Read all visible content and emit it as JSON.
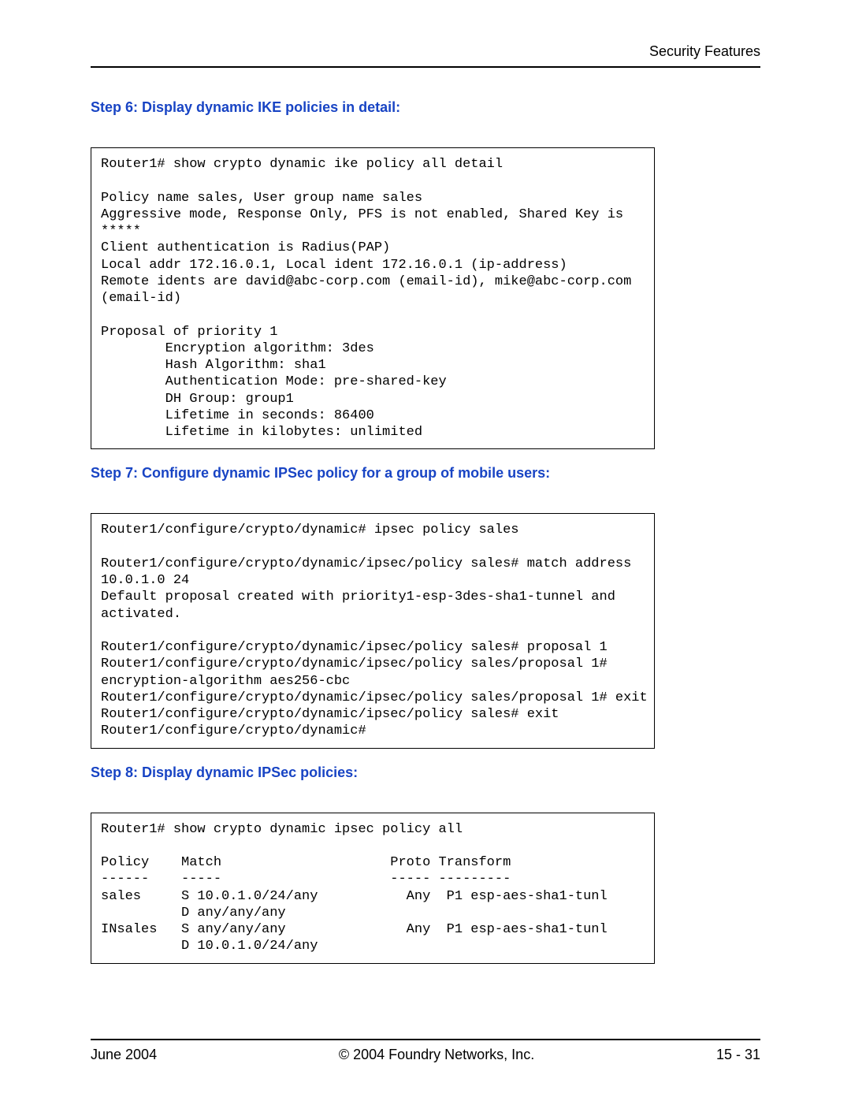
{
  "header": {
    "right_text": "Security Features"
  },
  "sections": {
    "step6": {
      "heading": "Step 6: Display dynamic IKE policies in detail:",
      "code": "Router1# show crypto dynamic ike policy all detail\n\nPolicy name sales, User group name sales\nAggressive mode, Response Only, PFS is not enabled, Shared Key is \n*****\nClient authentication is Radius(PAP)\nLocal addr 172.16.0.1, Local ident 172.16.0.1 (ip-address)\nRemote idents are david@abc-corp.com (email-id), mike@abc-corp.com \n(email-id)\n\nProposal of priority 1\n        Encryption algorithm: 3des\n        Hash Algorithm: sha1\n        Authentication Mode: pre-shared-key\n        DH Group: group1\n        Lifetime in seconds: 86400\n        Lifetime in kilobytes: unlimited"
    },
    "step7": {
      "heading": "Step 7: Configure dynamic IPSec policy for a group of mobile users:",
      "code": "Router1/configure/crypto/dynamic# ipsec policy sales\n\nRouter1/configure/crypto/dynamic/ipsec/policy sales# match address \n10.0.1.0 24\nDefault proposal created with priority1-esp-3des-sha1-tunnel and \nactivated.\n\nRouter1/configure/crypto/dynamic/ipsec/policy sales# proposal 1\nRouter1/configure/crypto/dynamic/ipsec/policy sales/proposal 1# \nencryption-algorithm aes256-cbc\nRouter1/configure/crypto/dynamic/ipsec/policy sales/proposal 1# exit\nRouter1/configure/crypto/dynamic/ipsec/policy sales# exit\nRouter1/configure/crypto/dynamic#"
    },
    "step8": {
      "heading": "Step 8: Display dynamic IPSec policies:",
      "code": "Router1# show crypto dynamic ipsec policy all\n\nPolicy    Match                     Proto Transform\n------    -----                     ----- ---------\nsales     S 10.0.1.0/24/any           Any  P1 esp-aes-sha1-tunl\n          D any/any/any\nINsales   S any/any/any               Any  P1 esp-aes-sha1-tunl\n          D 10.0.1.0/24/any"
    }
  },
  "footer": {
    "left": "June 2004",
    "center": "© 2004 Foundry Networks, Inc.",
    "right": "15 - 31"
  }
}
